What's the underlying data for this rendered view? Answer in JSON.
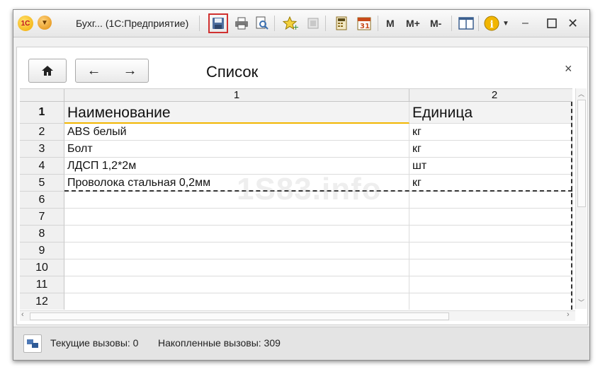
{
  "window": {
    "title": "Бухг... (1С:Предприятие)",
    "toolbar_m": [
      "M",
      "M+",
      "M-"
    ]
  },
  "form": {
    "title": "Список",
    "close_symbol": "×",
    "nav": {
      "home": "⌂",
      "back": "←",
      "forward": "→"
    }
  },
  "grid": {
    "column_numbers": [
      "1",
      "2"
    ],
    "header_row_number": "1",
    "headers": [
      "Наименование",
      "Единица"
    ],
    "rows": [
      {
        "num": "2",
        "name": "ABS белый",
        "unit": "кг"
      },
      {
        "num": "3",
        "name": "Болт",
        "unit": "кг"
      },
      {
        "num": "4",
        "name": "ЛДСП 1,2*2м",
        "unit": "шт"
      },
      {
        "num": "5",
        "name": "Проволока стальная 0,2мм",
        "unit": "кг"
      },
      {
        "num": "6",
        "name": "",
        "unit": ""
      },
      {
        "num": "7",
        "name": "",
        "unit": ""
      },
      {
        "num": "8",
        "name": "",
        "unit": ""
      },
      {
        "num": "9",
        "name": "",
        "unit": ""
      },
      {
        "num": "10",
        "name": "",
        "unit": ""
      },
      {
        "num": "11",
        "name": "",
        "unit": ""
      },
      {
        "num": "12",
        "name": "",
        "unit": ""
      }
    ],
    "selected_header_color": "#f2b600"
  },
  "watermark": "1S83.info",
  "status": {
    "current_calls": "Текущие вызовы: 0",
    "accumulated_calls": "Накопленные вызовы: 309"
  },
  "icons": {
    "save": "save-icon",
    "print": "printer-icon",
    "preview": "print-preview-icon",
    "favorites": "favorites-icon",
    "history": "history-icon",
    "calculator": "calculator-icon",
    "calendar": "calendar-icon",
    "windows": "windows-icon",
    "info": "info-icon"
  }
}
